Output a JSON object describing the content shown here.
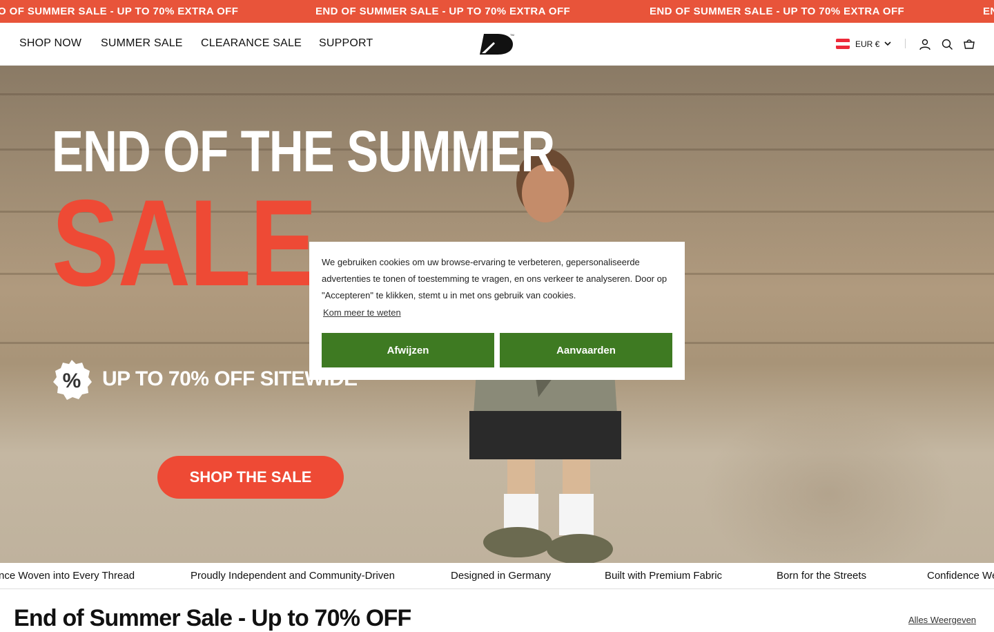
{
  "announcement": {
    "text": "END OF SUMMER SALE - UP TO 70% EXTRA OFF",
    "first_partial": "O OF SUMMER SALE - UP TO 70% EXTRA OFF",
    "last_partial": "EN",
    "color": "#e8543a"
  },
  "nav": {
    "items": [
      {
        "label": "SHOP NOW"
      },
      {
        "label": "SUMMER SALE"
      },
      {
        "label": "CLEARANCE SALE"
      },
      {
        "label": "SUPPORT"
      }
    ]
  },
  "header": {
    "logo_icon": "brand-logo",
    "currency": "EUR €",
    "icons": [
      "account-icon",
      "search-icon",
      "cart-icon"
    ]
  },
  "hero": {
    "line1": "END OF THE SUMMER",
    "line2": "SALE",
    "offer": "UP TO 70% OFF SITEWIDE",
    "badge_symbol": "%",
    "cta": "SHOP THE SALE",
    "accent_color": "#ee4a35"
  },
  "cookie": {
    "text": "We gebruiken cookies om uw browse-ervaring te verbeteren, gepersonaliseerde advertenties te tonen of toestemming te vragen, en ons verkeer te analyseren. Door op \"Accepteren\" te klikken, stemt u in met ons gebruik van cookies.",
    "learn_more": "Kom meer te weten",
    "reject": "Afwijzen",
    "accept": "Aanvaarden",
    "button_color": "#3e7a22"
  },
  "ticker": {
    "items": [
      "nce Woven into Every Thread",
      "Proudly Independent and Community-Driven",
      "Designed in Germany",
      "Built with Premium Fabric",
      "Born for the Streets",
      "Confidence We"
    ]
  },
  "section": {
    "title": "End of Summer Sale - Up to 70% OFF",
    "view_all": "Alles Weergeven"
  }
}
